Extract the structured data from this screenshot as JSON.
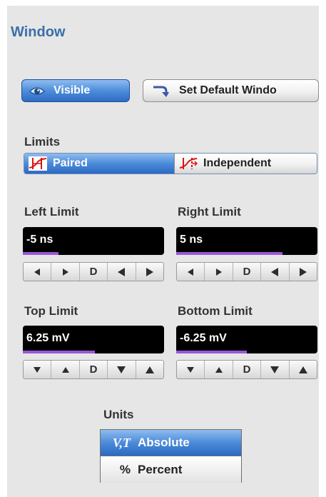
{
  "panel": {
    "title": "Window"
  },
  "buttons": {
    "visible": {
      "label": "Visible",
      "icon": "eye-icon"
    },
    "set_default": {
      "label": "Set Default Windo",
      "icon": "return-arrow-icon"
    }
  },
  "limits": {
    "label": "Limits",
    "options": [
      {
        "label": "Paired",
        "icon": "paired-limits-icon",
        "selected": true
      },
      {
        "label": "Independent",
        "icon": "independent-limits-icon",
        "selected": false
      }
    ]
  },
  "left_limit": {
    "label": "Left Limit",
    "value": "-5 ns",
    "level": 0.25
  },
  "right_limit": {
    "label": "Right Limit",
    "value": "5 ns",
    "level": 0.75
  },
  "top_limit": {
    "label": "Top Limit",
    "value": "6.25 mV",
    "level": 0.51
  },
  "bottom_limit": {
    "label": "Bottom Limit",
    "value": "-6.25 mV",
    "level": 0.5
  },
  "stepper_default_label": "D",
  "units": {
    "label": "Units",
    "options": [
      {
        "symbol": "V,T",
        "label": "Absolute",
        "selected": true
      },
      {
        "symbol": "%",
        "label": "Percent",
        "selected": false
      }
    ]
  },
  "colors": {
    "title_blue": "#3a6fa8",
    "selected_blue": "#4b8bd9",
    "indicator_purple": "#9a57d8",
    "panel_gray": "#e6e6e6"
  }
}
